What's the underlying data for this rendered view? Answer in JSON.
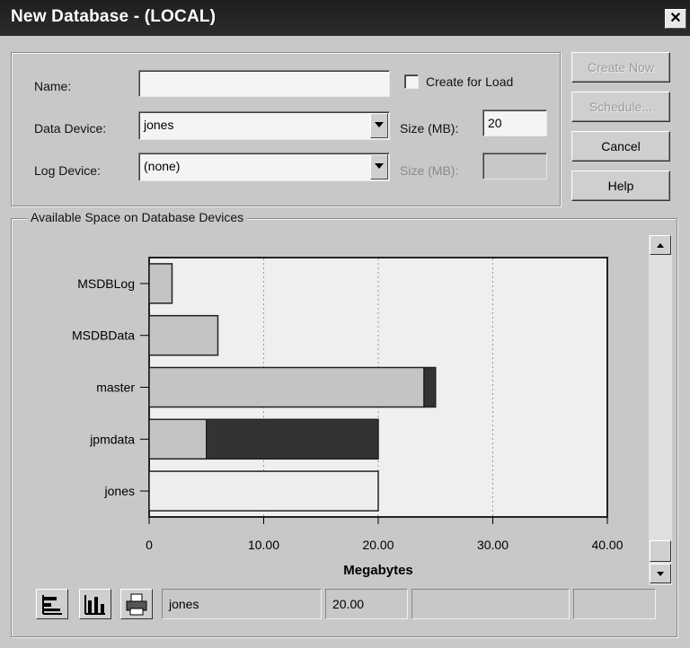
{
  "window": {
    "title": "New Database - (LOCAL)",
    "close_glyph": "✕"
  },
  "form": {
    "name_label": "Name:",
    "name_value": "",
    "create_for_load_label": "Create for Load",
    "data_device_label": "Data Device:",
    "data_device_value": "jones",
    "size_label": "Size (MB):",
    "size_value": "20",
    "log_device_label": "Log Device:",
    "log_device_value": "(none)",
    "log_size_label": "Size (MB):"
  },
  "buttons": {
    "create_now": "Create Now",
    "schedule": "Schedule...",
    "cancel": "Cancel",
    "help": "Help"
  },
  "chart_section": {
    "title": "Available Space on Database Devices"
  },
  "chart_data": {
    "type": "bar",
    "orientation": "horizontal",
    "stacked": true,
    "categories": [
      "MSDBLog",
      "MSDBData",
      "master",
      "jpmdata",
      "jones"
    ],
    "series": [
      {
        "values": [
          2,
          6,
          24,
          5,
          0
        ],
        "color": "#c4c4c4"
      },
      {
        "values": [
          0,
          0,
          1,
          15,
          0
        ],
        "color": "#333333"
      },
      {
        "values": [
          0,
          0,
          0,
          0,
          20
        ],
        "color": "#eeeeee"
      }
    ],
    "xticks": [
      "0",
      "10.00",
      "20.00",
      "30.00",
      "40.00"
    ],
    "xlim": [
      0,
      40
    ],
    "xlabel": "Megabytes",
    "grid": "vertical dotted"
  },
  "status_bar": {
    "device": "jones",
    "size": "20.00",
    "field3": "",
    "field4": ""
  },
  "icons": {
    "tool1": "horizontal-bar-chart-icon",
    "tool2": "vertical-bar-chart-icon",
    "tool3": "print-icon"
  }
}
